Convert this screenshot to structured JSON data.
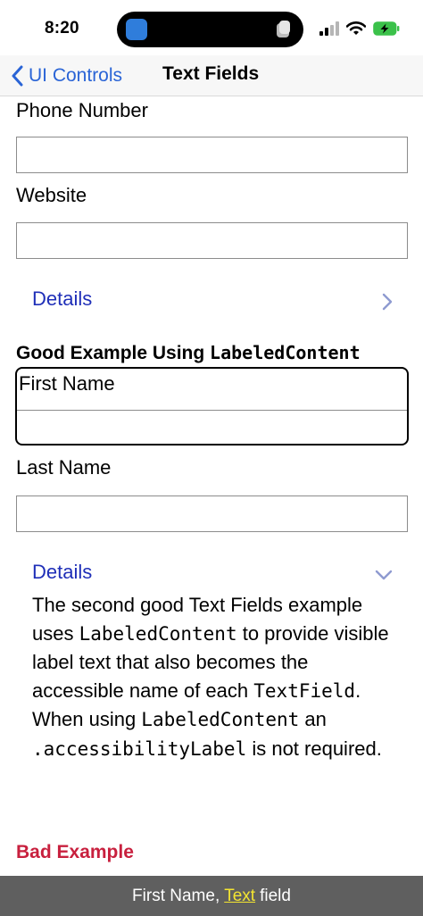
{
  "status_bar": {
    "time": "8:20",
    "icons": [
      "cellular-signal-icon",
      "wifi-icon",
      "battery-charging-icon"
    ]
  },
  "nav": {
    "back_label": "UI Controls",
    "title": "Text Fields"
  },
  "fields_top": {
    "phone_label": "Phone Number",
    "website_label": "Website"
  },
  "details_collapsed": {
    "label": "Details",
    "chevron": "chevron-right-icon"
  },
  "good_example": {
    "heading_prefix": "Good Example Using ",
    "heading_code": "LabeledContent",
    "first_name_label": "First Name",
    "last_name_label": "Last Name"
  },
  "details_expanded": {
    "label": "Details",
    "chevron": "chevron-down-icon",
    "text_1": "The second good Text Fields example uses ",
    "code_1": "LabeledContent",
    "text_2": " to provide visible label text that also becomes the accessible name of each ",
    "code_2": "TextField",
    "text_3": ". When using ",
    "code_3": "LabeledContent",
    "text_4": " an ",
    "code_4": ".accessibilityLabel",
    "text_5": " is not required."
  },
  "bad_example": {
    "heading": "Bad Example"
  },
  "voiceover": {
    "prefix": "First Name,",
    "highlight": "Text",
    "suffix": "field"
  },
  "colors": {
    "link_blue": "#2a64d6",
    "details_blue": "#1f2fb8",
    "bad_red": "#c8203e",
    "highlight_yellow": "#f4e531"
  }
}
